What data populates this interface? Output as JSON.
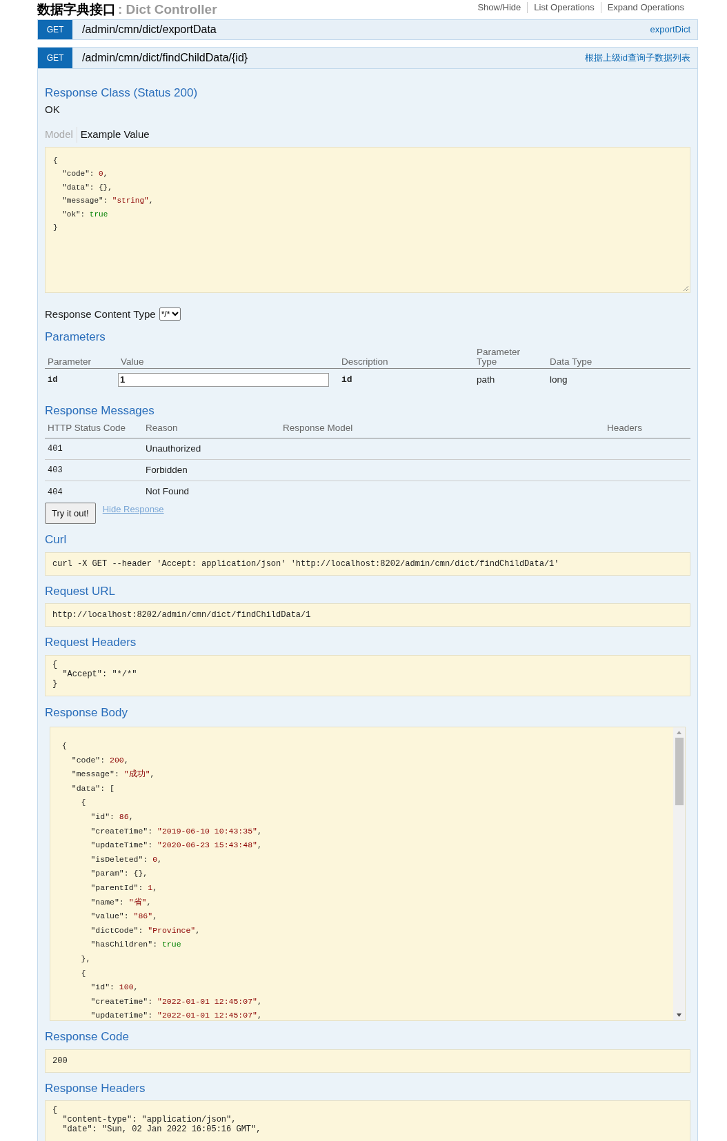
{
  "header": {
    "title": "数据字典接口",
    "subtitle": ": Dict Controller",
    "links": [
      "Show/Hide",
      "List Operations",
      "Expand Operations"
    ]
  },
  "operations": [
    {
      "method": "GET",
      "path": "/admin/cmn/dict/exportData",
      "summary": "exportDict",
      "expanded": false
    },
    {
      "method": "GET",
      "path": "/admin/cmn/dict/findChildData/{id}",
      "summary": "根据上级id查询子数据列表",
      "expanded": true,
      "detail": {
        "response_class": {
          "heading": "Response Class (Status 200)",
          "status": "OK"
        },
        "model_tabs": [
          {
            "label": "Model",
            "selected": false
          },
          {
            "label": "Example Value",
            "selected": true
          }
        ],
        "example_value": {
          "highlighted": true,
          "lines": [
            "{",
            "  \"code\": 0,",
            "  \"data\": {},",
            "  \"message\": \"string\",",
            "  \"ok\": true",
            "}"
          ]
        },
        "content_type": {
          "label": "Response Content Type",
          "value": "*/*"
        },
        "parameters": {
          "heading": "Parameters",
          "columns": [
            "Parameter",
            "Value",
            "Description",
            "Parameter Type",
            "Data Type"
          ],
          "rows": [
            {
              "parameter": "id",
              "value": "1",
              "description": "id",
              "parameter_type": "path",
              "data_type": "long"
            }
          ]
        },
        "response_messages": {
          "heading": "Response Messages",
          "columns": [
            "HTTP Status Code",
            "Reason",
            "Response Model",
            "Headers"
          ],
          "rows": [
            {
              "code": "401",
              "reason": "Unauthorized"
            },
            {
              "code": "403",
              "reason": "Forbidden"
            },
            {
              "code": "404",
              "reason": "Not Found"
            }
          ]
        },
        "try_button": "Try it out!",
        "hide_link": "Hide Response",
        "sections": [
          {
            "kind": "block",
            "heading": "Curl",
            "highlighted": false,
            "lines": [
              "curl -X GET --header 'Accept: application/json' 'http://localhost:8202/admin/cmn/dict/findChildData/1'"
            ]
          },
          {
            "kind": "block",
            "heading": "Request URL",
            "highlighted": false,
            "lines": [
              "http://localhost:8202/admin/cmn/dict/findChildData/1"
            ]
          },
          {
            "kind": "block",
            "heading": "Request Headers",
            "highlighted": false,
            "lines": [
              "{",
              "  \"Accept\": \"*/*\"",
              "}"
            ]
          },
          {
            "kind": "scroll",
            "heading": "Response Body",
            "highlighted": true,
            "lines": [
              "{",
              "  \"code\": 200,",
              "  \"message\": \"成功\",",
              "  \"data\": [",
              "    {",
              "      \"id\": 86,",
              "      \"createTime\": \"2019-06-10 10:43:35\",",
              "      \"updateTime\": \"2020-06-23 15:43:48\",",
              "      \"isDeleted\": 0,",
              "      \"param\": {},",
              "      \"parentId\": 1,",
              "      \"name\": \"省\",",
              "      \"value\": \"86\",",
              "      \"dictCode\": \"Province\",",
              "      \"hasChildren\": true",
              "    },",
              "    {",
              "      \"id\": 100,",
              "      \"createTime\": \"2022-01-01 12:45:07\",",
              "      \"updateTime\": \"2022-01-01 12:45:07\","
            ]
          },
          {
            "kind": "block",
            "heading": "Response Code",
            "highlighted": false,
            "lines": [
              "200"
            ]
          },
          {
            "kind": "block",
            "heading": "Response Headers",
            "highlighted": false,
            "lines": [
              "{",
              "  \"content-type\": \"application/json\",",
              "  \"date\": \"Sun, 02 Jan 2022 16:05:16 GMT\","
            ]
          }
        ]
      }
    }
  ]
}
